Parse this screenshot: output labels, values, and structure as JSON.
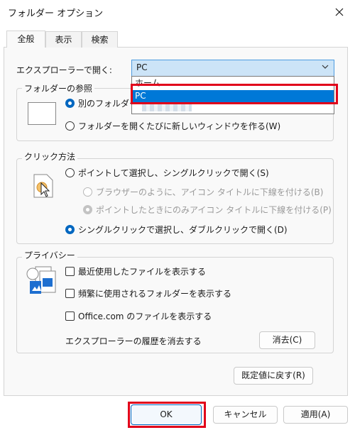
{
  "window": {
    "title": "フォルダー オプション"
  },
  "tabs": [
    {
      "label": "全般"
    },
    {
      "label": "表示"
    },
    {
      "label": "検索"
    }
  ],
  "open_with": {
    "label": "エクスプローラーで開く:",
    "selected_value": "PC",
    "options": [
      {
        "label": "ホーム"
      },
      {
        "label": "PC"
      }
    ]
  },
  "browse_folders": {
    "title": "フォルダーの参照",
    "options": [
      {
        "label": "別のフォルダー",
        "selected": true
      },
      {
        "label": "フォルダーを開くたびに新しいウィンドウを作る(W)",
        "selected": false
      }
    ]
  },
  "click_method": {
    "title": "クリック方法",
    "options": [
      {
        "label": "ポイントして選択し、シングルクリックで開く(S)",
        "selected": false
      },
      {
        "label": "ブラウザーのように、アイコン タイトルに下線を付ける(B)",
        "selected": false
      },
      {
        "label": "ポイントしたときにのみアイコン タイトルに下線を付ける(P)",
        "selected": true
      },
      {
        "label": "シングルクリックで選択し、ダブルクリックで開く(D)",
        "selected": true
      }
    ]
  },
  "privacy": {
    "title": "プライバシー",
    "checks": [
      {
        "label": "最近使用したファイルを表示する",
        "checked": false
      },
      {
        "label": "頻繁に使用されるフォルダーを表示する",
        "checked": false
      },
      {
        "label": "Office.com のファイルを表示する",
        "checked": false
      }
    ],
    "clear_history_label": "エクスプローラーの履歴を消去する",
    "clear_button": "消去(C)"
  },
  "restore_defaults_button": "既定値に戻す(R)",
  "footer": {
    "ok": "OK",
    "cancel": "キャンセル",
    "apply": "適用(A)"
  },
  "colors": {
    "accent": "#0067c0",
    "highlight": "#e1001a",
    "selection": "#0078d7"
  }
}
